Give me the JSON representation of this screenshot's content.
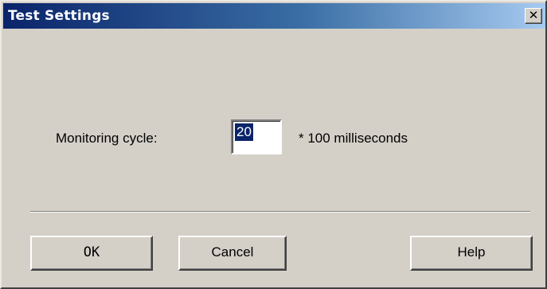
{
  "window": {
    "title": "Test Settings",
    "close_glyph": "✕"
  },
  "form": {
    "monitoring_label": "Monitoring cycle:",
    "monitoring_value": "20",
    "units_label": "* 100 milliseconds"
  },
  "buttons": {
    "ok": "OK",
    "cancel": "Cancel",
    "help": "Help"
  },
  "colors": {
    "titlebar_start": "#0a246a",
    "titlebar_end": "#a6caf0",
    "dialog_face": "#d4d0c8",
    "selection": "#0a246a"
  },
  "icons": {
    "close": "close-icon"
  }
}
